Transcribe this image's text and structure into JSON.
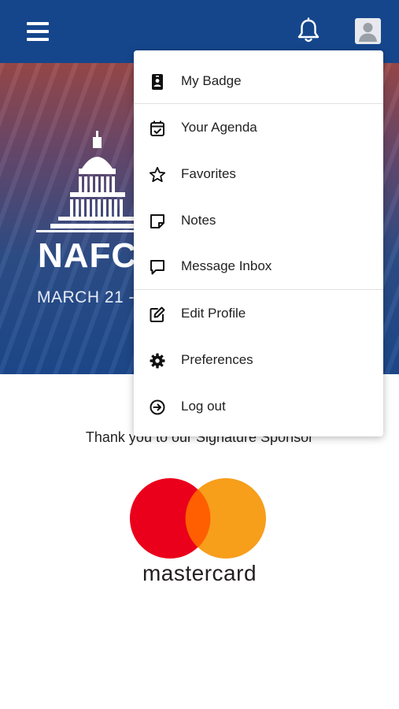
{
  "topbar": {
    "menu_icon": "hamburger-menu-icon",
    "notification_icon": "bell-icon",
    "profile_icon": "user-avatar-icon",
    "bg_color": "#15468c"
  },
  "hero": {
    "title": "NAFC",
    "date": "MARCH 21 -",
    "logo_icon": "capitol-dome-icon"
  },
  "sponsor": {
    "heading": "Thank you to our Signature Sponsor",
    "logo_name": "mastercard",
    "logo_colors": {
      "left_circle": "#eb001b",
      "right_circle": "#f79e1b",
      "overlap": "#ff5f00"
    }
  },
  "menu": {
    "items": [
      {
        "label": "My Badge",
        "icon": "badge-icon"
      },
      {
        "label": "Your Agenda",
        "icon": "calendar-check-icon"
      },
      {
        "label": "Favorites",
        "icon": "star-icon"
      },
      {
        "label": "Notes",
        "icon": "sticky-note-icon"
      },
      {
        "label": "Message Inbox",
        "icon": "chat-bubble-icon"
      },
      {
        "label": "Edit Profile",
        "icon": "edit-icon"
      },
      {
        "label": "Preferences",
        "icon": "gear-icon"
      },
      {
        "label": "Log out",
        "icon": "logout-icon"
      }
    ]
  }
}
